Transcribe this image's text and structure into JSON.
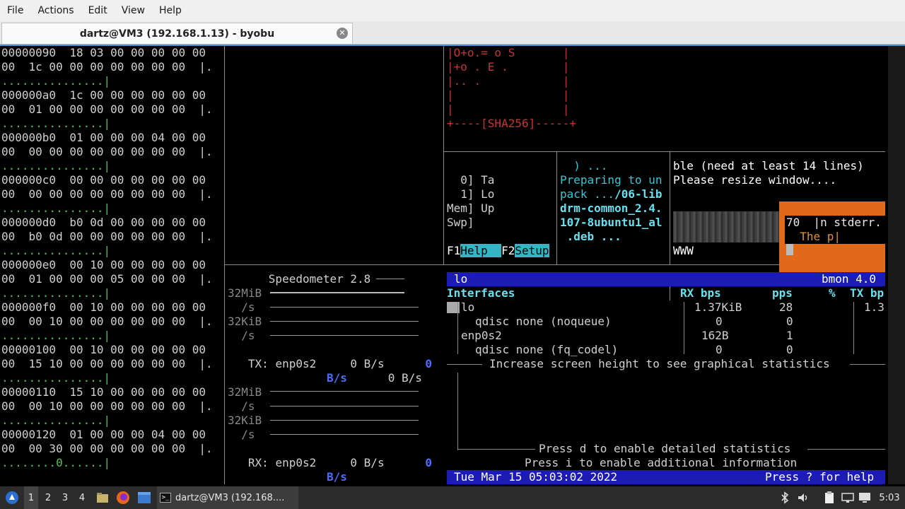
{
  "menubar": {
    "items": [
      "File",
      "Actions",
      "Edit",
      "View",
      "Help"
    ]
  },
  "tab": {
    "title": "dartz@VM3 (192.168.1.13) - byobu"
  },
  "hexdump": [
    "00000090  18 03 00 00 00 00 00",
    "00  1c 00 00 00 00 00 00 00  |.",
    "...............|",
    "000000a0  1c 00 00 00 00 00 00",
    "00  01 00 00 00 00 00 00 00  |.",
    "...............|",
    "000000b0  01 00 00 00 04 00 00",
    "00  00 00 00 00 00 00 00 00  |.",
    "...............|",
    "000000c0  00 00 00 00 00 00 00",
    "00  00 00 00 00 00 00 00 00  |.",
    "...............|",
    "000000d0  b0 0d 00 00 00 00 00",
    "00  b0 0d 00 00 00 00 00 00  |.",
    "...............|",
    "000000e0  00 10 00 00 00 00 00",
    "00  01 00 00 00 05 00 00 00  |.",
    "...............|",
    "000000f0  00 10 00 00 00 00 00",
    "00  00 10 00 00 00 00 00 00  |.",
    "...............|",
    "00000100  00 10 00 00 00 00 00",
    "00  15 10 00 00 00 00 00 00  |.",
    "...............|",
    "00000110  15 10 00 00 00 00 00",
    "00  00 10 00 00 00 00 00 00  |.",
    "...............|",
    "00000120  01 00 00 00 04 00 00",
    "00  00 30 00 00 00 00 00 00  |.",
    "........0......|"
  ],
  "sshart": [
    "|O+o.= o S       |",
    "|+o . E .        |",
    "|.. .            |",
    "|                |",
    "|                |",
    "+----[SHA256]-----+"
  ],
  "htop": {
    "rows": [
      "  0] Ta",
      "  1] Lo",
      "Mem] Up",
      "Swp]"
    ],
    "f1_key": "F1",
    "f1_label": "Help",
    "f2_key": "F2",
    "f2_label": "Setup"
  },
  "apt": {
    "line1": ") ...",
    "line2": "Preparing to un",
    "line3_prefix": "pack ...",
    "line3_path": "/06-lib",
    "line4": "drm-common_2.4.",
    "line5": "107-8ubuntu1_al",
    "line6": ".deb ..."
  },
  "resize": {
    "line1": "ble (need at least 14 lines)",
    "line2": "Please resize window....",
    "www": "WWW",
    "err1": "70  |n stderr.",
    "err2": "The p|"
  },
  "speedometer": {
    "title": "Speedometer 2.8",
    "label_mib": "32MiB",
    "label_s": "/s",
    "label_kib": "32KiB",
    "tx_label": "TX: enp0s2",
    "tx_value": "0 B/s",
    "tx_value2": "0 B/s",
    "tx_unit": "B/s",
    "rx_label": "RX: enp0s2",
    "rx_value": "0 B/s",
    "rx_unit": "B/s",
    "zero": "0"
  },
  "bmon": {
    "iface_header": "lo",
    "version": "bmon 4.0",
    "col_interfaces": "Interfaces",
    "col_rx_bps": "RX bps",
    "col_pps": "pps",
    "col_pct": "%",
    "col_tx_bps": "TX bp",
    "rows": [
      {
        "name": "lo",
        "rx": "1.37KiB",
        "pps": "28",
        "tx": "1.3"
      },
      {
        "name": "qdisc none (noqueue)",
        "rx": "0",
        "pps": "0",
        "tx": ""
      },
      {
        "name": "enp0s2",
        "rx": "162B",
        "pps": "1",
        "tx": ""
      },
      {
        "name": "qdisc none (fq_codel)",
        "rx": "0",
        "pps": "0",
        "tx": ""
      }
    ],
    "msg_increase": "Increase screen height to see graphical statistics",
    "msg_detail": "Press d to enable detailed statistics",
    "msg_info": "Press i to enable additional information",
    "date": "Tue Mar 15 05:03:02 2022",
    "help": "Press ? for help"
  },
  "taskbar": {
    "workspaces": [
      "1",
      "2",
      "3",
      "4"
    ],
    "window_title": "dartz@VM3 (192.168....",
    "clock": "5:03"
  },
  "colors": {
    "accent": "#4a90d9",
    "bmon_bar": "#1c1cb4",
    "orange": "#e06a1a",
    "hex_green": "#4ec24e",
    "ssh_red": "#c83232",
    "htop_cyan": "#33c8d8"
  }
}
